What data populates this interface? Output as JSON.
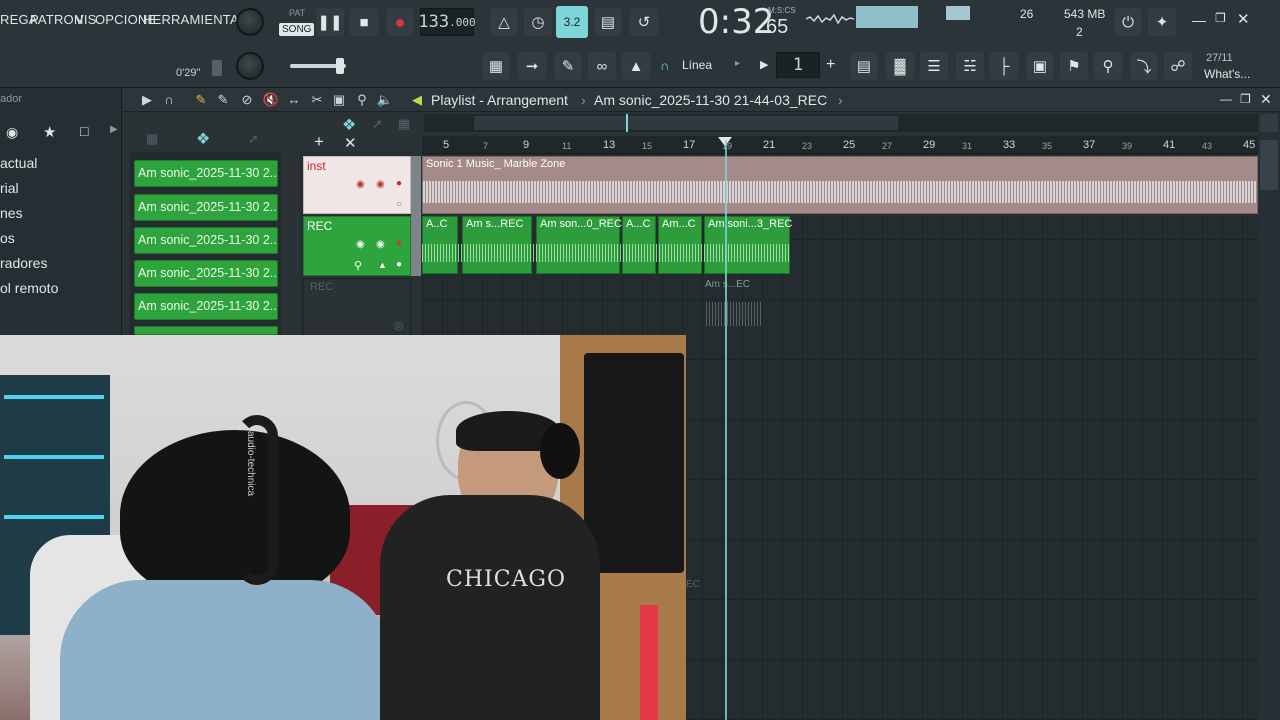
{
  "menu": {
    "items": [
      "REGA",
      "PATRON",
      "VIS",
      "OPCIONE",
      "HERRAMIENTA"
    ],
    "time_small": "0'29''"
  },
  "transport": {
    "pat_label": "PAT",
    "song_label": "SONG",
    "tempo": "133",
    "tempo_decimals": ".000",
    "time": "0:32",
    "time_cs": "65",
    "time_format": "M:S:CS",
    "pattern_number": "1",
    "snap_label": "Línea"
  },
  "status": {
    "cpu": "26",
    "memory": "543 MB",
    "polyphony": "2",
    "news_date": "27/11",
    "news_label": "What's..."
  },
  "browser": {
    "title": "ador",
    "items": [
      "actual",
      "rial",
      "nes",
      "os",
      "radores",
      "ol remoto"
    ]
  },
  "playlist": {
    "title": "Playlist - Arrangement",
    "breadcrumb": "Am sonic_2025-11-30 21-44-03_REC",
    "patterns": [
      "Am sonic_2025-11-30 2...",
      "Am sonic_2025-11-30 2...",
      "Am sonic_2025-11-30 2...",
      "Am sonic_2025-11-30 2...",
      "Am sonic_2025-11-30 2..."
    ],
    "tracks": [
      {
        "name": "inst"
      },
      {
        "name": "REC"
      },
      {
        "name": "REC"
      }
    ],
    "ruler_major": [
      "5",
      "9",
      "13",
      "17",
      "21",
      "25",
      "29",
      "33",
      "37",
      "41",
      "45"
    ],
    "ruler_minor": [
      "7",
      "11",
      "15",
      "19",
      "23",
      "27",
      "31",
      "35",
      "39",
      "43"
    ],
    "inst_clip": "Sonic 1 Music_ Marble Zone",
    "rec_clips": [
      "A..C",
      "Am s...REC",
      "Am son...0_REC",
      "A...C",
      "Am...C",
      "Am soni...3_REC"
    ],
    "ghost_clip": "Am s...EC",
    "edge_label": "EC"
  },
  "colors": {
    "clip_green": "#2ea43c",
    "inst_clip": "#a48a88",
    "playhead": "#7fd6d8",
    "record_red": "#e0343c"
  },
  "webcam": {
    "shirt_text": "CHICAGO",
    "headphone_brand": "audio-technica"
  }
}
